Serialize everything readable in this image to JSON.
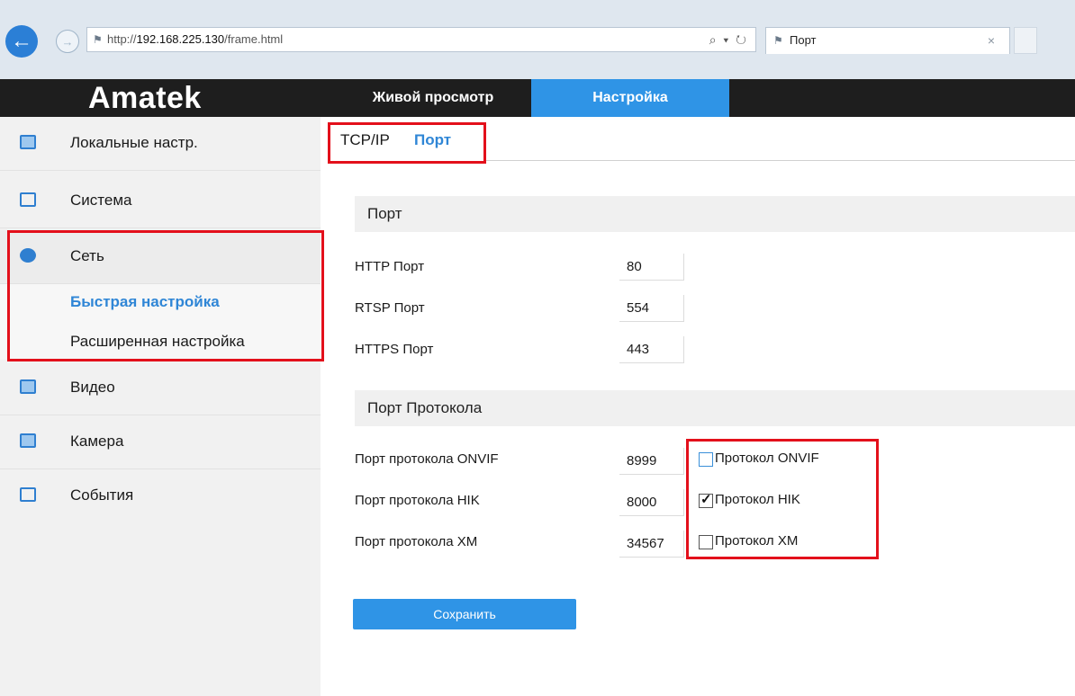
{
  "browser": {
    "url_prefix": "http://",
    "url_host": "192.168.225.130",
    "url_path": "/frame.html",
    "address_tools": "⌕ ▾ ↻",
    "tab_title": "Порт",
    "tab_close": "×"
  },
  "header": {
    "logo": "Amatek",
    "nav": [
      {
        "label": "Живой просмотр",
        "active": false
      },
      {
        "label": "Настройка",
        "active": true
      }
    ]
  },
  "sidebar": {
    "items": [
      {
        "label": "Локальные настр.",
        "icon": "monitor-icon"
      },
      {
        "label": "Система",
        "icon": "system-icon"
      },
      {
        "label": "Сеть",
        "icon": "globe-icon"
      },
      {
        "label": "Видео",
        "icon": "video-icon"
      },
      {
        "label": "Камера",
        "icon": "image-icon"
      },
      {
        "label": "События",
        "icon": "events-icon"
      }
    ],
    "network_sub": [
      {
        "label": "Быстрая настройка",
        "active": true
      },
      {
        "label": "Расширенная настройка",
        "active": false
      }
    ]
  },
  "subtabs": [
    {
      "label": "TCP/IP",
      "active": false
    },
    {
      "label": "Порт",
      "active": true
    }
  ],
  "port_section": {
    "title": "Порт",
    "fields": [
      {
        "label": "HTTP Порт",
        "value": "80"
      },
      {
        "label": "RTSP Порт",
        "value": "554"
      },
      {
        "label": "HTTPS Порт",
        "value": "443"
      }
    ]
  },
  "protocol_section": {
    "title": "Порт Протокола",
    "fields": [
      {
        "label": "Порт протокола ONVIF",
        "value": "8999",
        "checkbox_label": "Протокол ONVIF",
        "checked": false
      },
      {
        "label": "Порт протокола HIK",
        "value": "8000",
        "checkbox_label": "Протокол HIK",
        "checked": true
      },
      {
        "label": "Порт протокола XM",
        "value": "34567",
        "checkbox_label": "Протокол XM",
        "checked": false
      }
    ]
  },
  "save_label": "Сохранить"
}
